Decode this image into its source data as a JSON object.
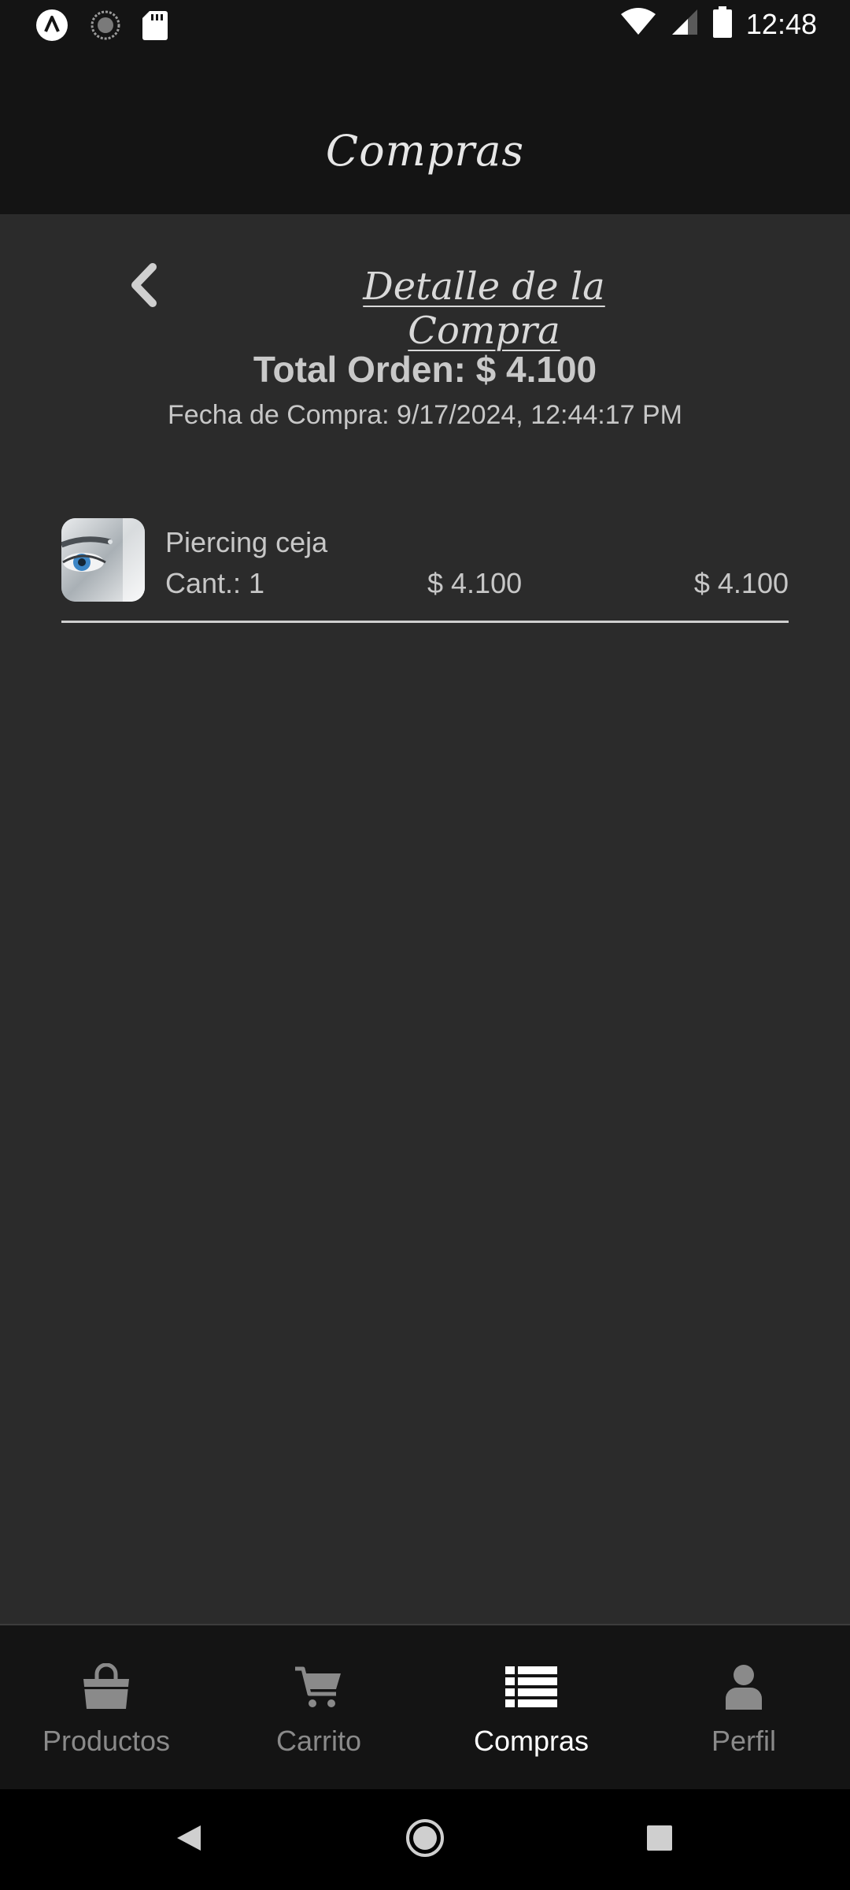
{
  "status_bar": {
    "time": "12:48"
  },
  "header": {
    "title": "Compras"
  },
  "detail": {
    "title": "Detalle de la Compra",
    "total": "Total Orden: $ 4.100",
    "date": "Fecha de Compra: 9/17/2024, 12:44:17 PM"
  },
  "items": [
    {
      "name": "Piercing ceja",
      "quantity": "Cant.: 1",
      "unit_price": "$ 4.100",
      "subtotal": "$ 4.100"
    }
  ],
  "tabs": [
    {
      "label": "Productos",
      "icon": "shopping-bag-icon",
      "active": false
    },
    {
      "label": "Carrito",
      "icon": "cart-icon",
      "active": false
    },
    {
      "label": "Compras",
      "icon": "list-icon",
      "active": true
    },
    {
      "label": "Perfil",
      "icon": "user-icon",
      "active": false
    }
  ],
  "colors": {
    "background": "#2b2b2b",
    "header": "#141414",
    "text": "#c7c7c7",
    "tab_inactive": "#8a8a8a",
    "tab_active": "#ffffff"
  }
}
